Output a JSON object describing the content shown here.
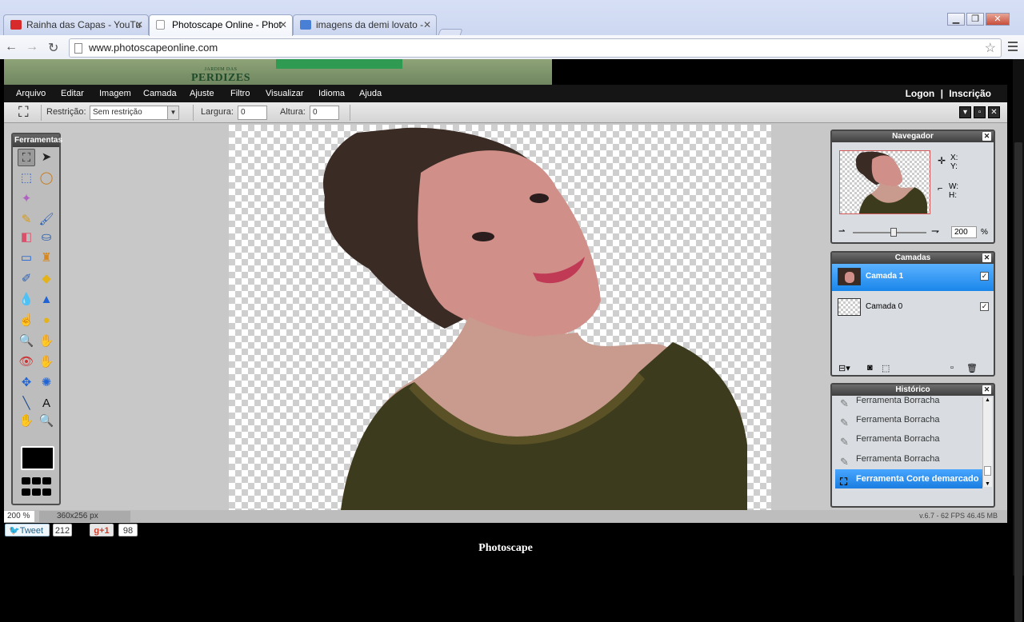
{
  "browser": {
    "tabs": [
      {
        "title": "Rainha das Capas - YouTu",
        "favicon": "youtube-icon",
        "active": false
      },
      {
        "title": "Photoscape Online - Phot",
        "favicon": "page-icon",
        "active": true
      },
      {
        "title": "imagens da demi lovato -",
        "favicon": "google-icon",
        "active": false
      }
    ],
    "url": "www.photoscapeonline.com",
    "window_buttons": [
      "minimize",
      "maximize",
      "close"
    ]
  },
  "ad_banner": {
    "brand_small": "JARDIM DAS",
    "brand": "PERDIZES"
  },
  "app": {
    "menu": [
      "Arquivo",
      "Editar",
      "Imagem",
      "Camada",
      "Ajuste",
      "Filtro",
      "Visualizar",
      "Idioma",
      "Ajuda"
    ],
    "logon": "Logon",
    "separator": "|",
    "signup": "Inscrição",
    "options": {
      "restriction_label": "Restrição:",
      "restriction_value": "Sem restrição",
      "width_label": "Largura:",
      "width_value": "0",
      "height_label": "Altura:",
      "height_value": "0"
    },
    "tools_panel": {
      "title": "Ferramentas",
      "tools": [
        {
          "name": "crop-tool-icon",
          "glyph": "⛶",
          "selected": true,
          "color": "#222"
        },
        {
          "name": "move-tool-icon",
          "glyph": "➤",
          "color": "#222"
        },
        {
          "name": "marquee-tool-icon",
          "glyph": "⬚",
          "color": "#3a6bc4"
        },
        {
          "name": "lasso-tool-icon",
          "glyph": "◯",
          "color": "#c77a1b"
        },
        {
          "name": "magic-wand-tool-icon",
          "glyph": "✦",
          "color": "#b05fc2"
        },
        {
          "name": "",
          "glyph": "",
          "color": "#000"
        },
        {
          "name": "pencil-tool-icon",
          "glyph": "✎",
          "color": "#d69a1c"
        },
        {
          "name": "brush-tool-icon",
          "glyph": "🖌",
          "color": "#2b5fb0"
        },
        {
          "name": "eraser-tool-icon",
          "glyph": "◧",
          "color": "#d9506a"
        },
        {
          "name": "fill-tool-icon",
          "glyph": "⛀",
          "color": "#2b5fb0"
        },
        {
          "name": "gradient-tool-icon",
          "glyph": "▭",
          "color": "#1f63d4"
        },
        {
          "name": "stamp-tool-icon",
          "glyph": "♜",
          "color": "#d9861c"
        },
        {
          "name": "colorpicker-tool-icon",
          "glyph": "✐",
          "color": "#2b5fb0"
        },
        {
          "name": "shape-tool-icon",
          "glyph": "◆",
          "color": "#e4b21a"
        },
        {
          "name": "blur-tool-icon",
          "glyph": "💧",
          "color": "#1f63d4"
        },
        {
          "name": "sharpen-tool-icon",
          "glyph": "▲",
          "color": "#1f63d4"
        },
        {
          "name": "smudge-tool-icon",
          "glyph": "☝",
          "color": "#d9861c"
        },
        {
          "name": "sponge-tool-icon",
          "glyph": "●",
          "color": "#e4b21a"
        },
        {
          "name": "burn-tool-icon",
          "glyph": "🔍",
          "color": "#222"
        },
        {
          "name": "dodge-tool-icon",
          "glyph": "✋",
          "color": "#d9861c"
        },
        {
          "name": "redeye-tool-icon",
          "glyph": "👁",
          "color": "#c33"
        },
        {
          "name": "bloat-tool-icon",
          "glyph": "✋",
          "color": "#d9861c"
        },
        {
          "name": "pinch-tool-icon",
          "glyph": "✥",
          "color": "#1f63d4"
        },
        {
          "name": "spherize-tool-icon",
          "glyph": "✺",
          "color": "#1f63d4"
        },
        {
          "name": "line-tool-icon",
          "glyph": "╲",
          "color": "#1f4b8a"
        },
        {
          "name": "text-tool-icon",
          "glyph": "A",
          "color": "#111"
        },
        {
          "name": "hand-tool-icon",
          "glyph": "✋",
          "color": "#d9861c"
        },
        {
          "name": "zoom-tool-icon",
          "glyph": "🔍",
          "color": "#222"
        }
      ],
      "foreground_color": "#000000"
    },
    "navigator": {
      "title": "Navegador",
      "x_label": "X:",
      "y_label": "Y:",
      "w_label": "W:",
      "h_label": "H:",
      "zoom_value": "200",
      "zoom_unit": "%",
      "zoom_level": 0.55
    },
    "layers": {
      "title": "Camadas",
      "items": [
        {
          "name": "Camada 1",
          "selected": true,
          "visible": true
        },
        {
          "name": "Camada 0",
          "selected": false,
          "visible": true
        }
      ]
    },
    "history": {
      "title": "Histórico",
      "items": [
        {
          "label": "Ferramenta Borracha",
          "selected": false
        },
        {
          "label": "Ferramenta Borracha",
          "selected": false
        },
        {
          "label": "Ferramenta Borracha",
          "selected": false
        },
        {
          "label": "Ferramenta Borracha",
          "selected": false
        },
        {
          "label": "Ferramenta Corte demarcado",
          "selected": true
        }
      ]
    },
    "status": {
      "zoom": "200 %",
      "dimensions": "360x256 px",
      "version": "v.6.7 - 62 FPS 46.45 MB"
    }
  },
  "social": {
    "tweet_label": "Tweet",
    "tweet_count": "212",
    "gplus_label": "+1",
    "gplus_count": "98"
  },
  "footer": {
    "title": "Photoscape"
  }
}
